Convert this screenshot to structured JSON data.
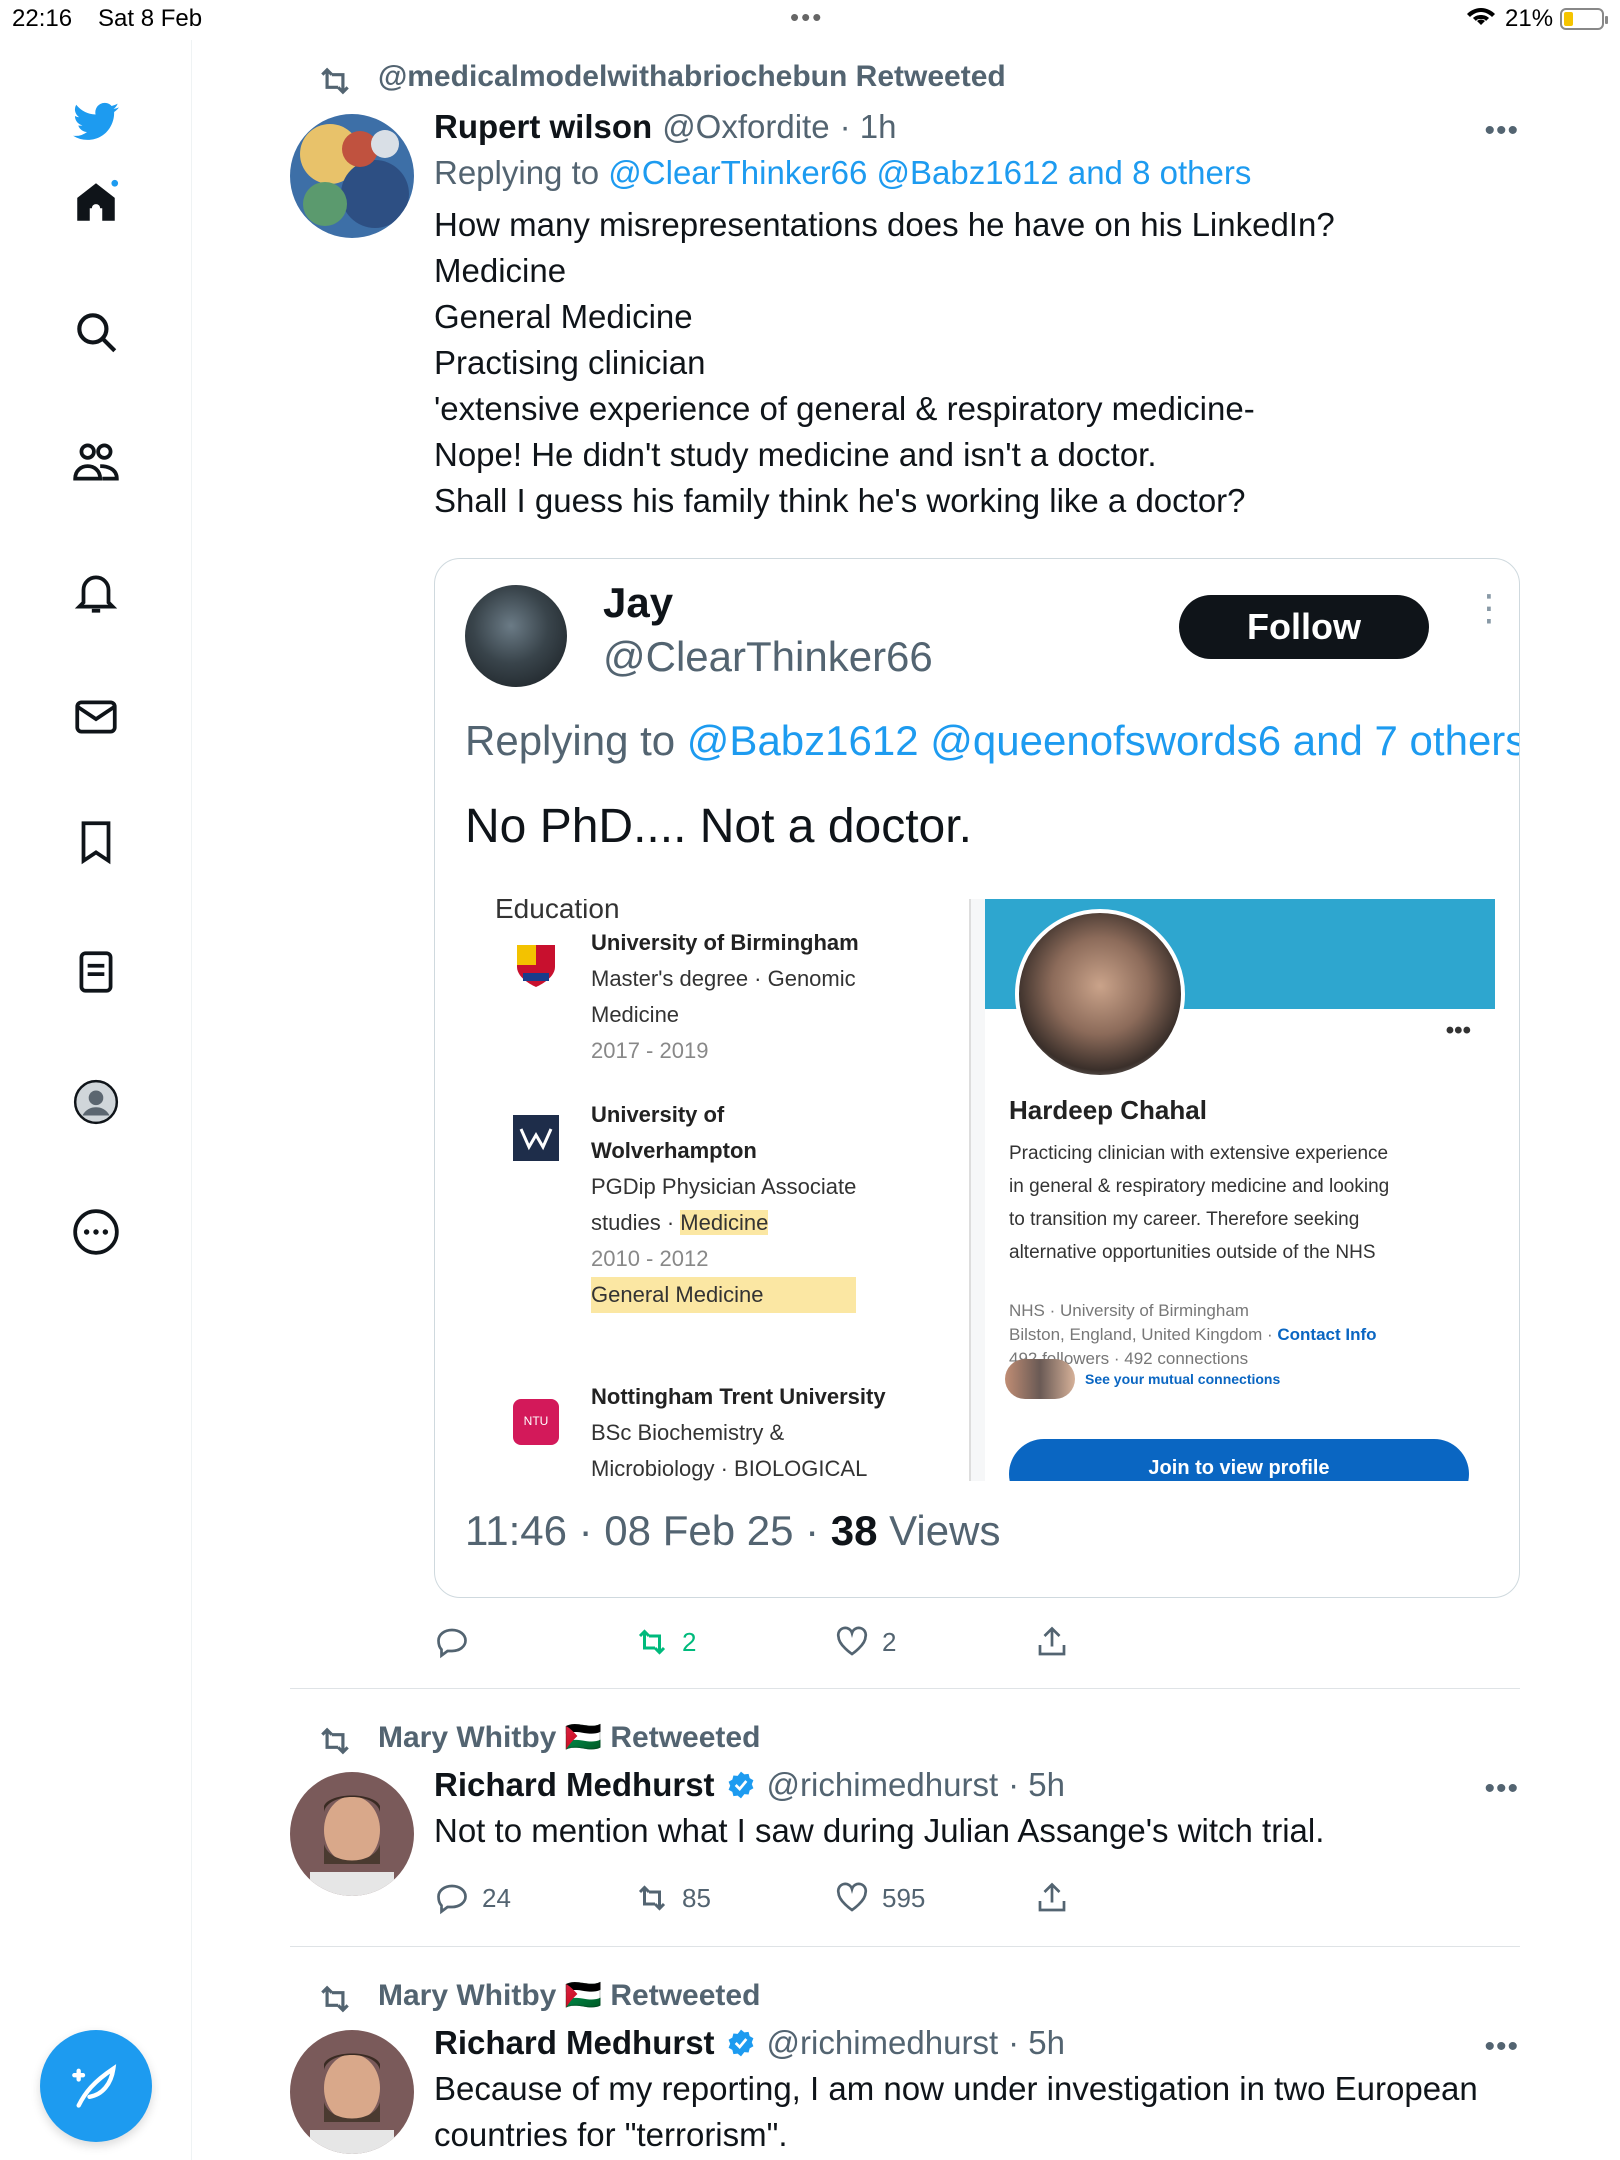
{
  "status_bar": {
    "time": "22:16",
    "date": "Sat 8 Feb",
    "battery": "21%"
  },
  "tweets": [
    {
      "retweeted_by": "@medicalmodelwithabriochebun Retweeted",
      "name": "Rupert wilson",
      "handle": "@Oxfordite",
      "time": "· 1h",
      "replying_prefix": "Replying to",
      "replying_to": "@ClearThinker66 @Babz1612 and 8 others",
      "text_lines": [
        "How many misrepresentations does he have on his LinkedIn?",
        "Medicine",
        "General Medicine",
        "Practising clinician",
        "'extensive experience of general & respiratory medicine-",
        "Nope! He didn't study medicine and isn't a doctor.",
        "Shall I guess his family think he's working like a doctor?"
      ],
      "reply_count": "",
      "retweet_count": "2",
      "like_count": "2"
    },
    {
      "retweeted_by": "Mary Whitby 🇵🇸 Retweeted",
      "name": "Richard Medhurst",
      "handle": "@richimedhurst",
      "time": "· 5h",
      "text_lines": [
        "Not to mention what I saw during Julian Assange's witch trial."
      ],
      "reply_count": "24",
      "retweet_count": "85",
      "like_count": "595"
    },
    {
      "retweeted_by": "Mary Whitby 🇵🇸 Retweeted",
      "name": "Richard Medhurst",
      "handle": "@richimedhurst",
      "time": "· 5h",
      "text_lines": [
        "Because of my reporting, I am now under investigation in two European",
        "countries for \"terrorism\"."
      ]
    }
  ],
  "quote": {
    "name": "Jay",
    "handle": "@ClearThinker66",
    "follow_label": "Follow",
    "replying_prefix": "Replying to",
    "replying_to": "@Babz1612 @queenofswords6 and 7 others",
    "text": "No PhD.... Not a doctor.",
    "timestamp": "11:46 · 08 Feb 25 ·",
    "views_count": "38",
    "views_label": "Views",
    "education": {
      "heading": "Education",
      "entries": [
        {
          "school": "University of Birmingham",
          "line1": "Master's degree · Genomic",
          "line2": "Medicine",
          "years": "2017 - 2019"
        },
        {
          "school_1": "University of",
          "school_2": "Wolverhampton",
          "line1": "PGDip Physician Associate",
          "line2a": "studies ·",
          "line2b": "Medicine",
          "years": "2010 - 2012",
          "extra": "General Medicine"
        },
        {
          "school": "Nottingham Trent University",
          "line1": "BSc Biochemistry &",
          "line2": "Microbiology · BIOLOGICAL",
          "logo_text": "NTU"
        }
      ]
    },
    "profile": {
      "name": "Hardeep Chahal",
      "bio_lines": [
        "Practicing clinician with extensive experience",
        "in general & respiratory medicine and looking",
        "to transition my career. Therefore seeking",
        "alternative opportunities outside of the NHS"
      ],
      "work": "NHS · University of Birmingham",
      "location": "Bilston, England, United Kingdom ·",
      "contact": "Contact Info",
      "stats": "492 followers · 492 connections",
      "mutual": "See your mutual connections",
      "join": "Join to view profile"
    }
  },
  "colors": {
    "accent": "#1d9bf0",
    "retweet_green": "#00ba7c",
    "text": "#0f1419",
    "secondary": "#536471"
  }
}
